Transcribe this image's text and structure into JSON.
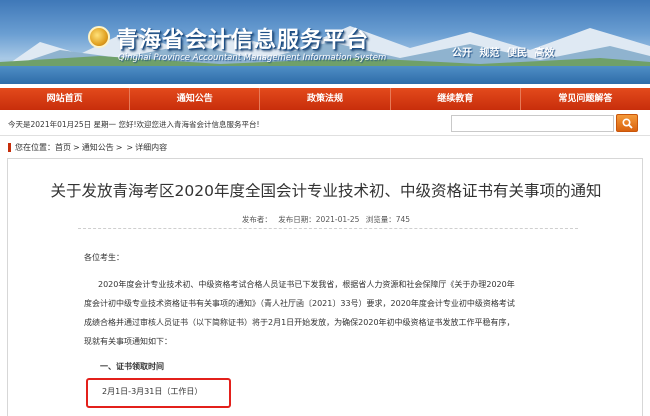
{
  "header": {
    "title": "青海省会计信息服务平台",
    "subtitle": "Qinghai Province Accountant Management Information System",
    "slogan": "公开 规范 便民 高效"
  },
  "nav": {
    "items": [
      "网站首页",
      "通知公告",
      "政策法规",
      "继续教育",
      "常见问题解答"
    ]
  },
  "infobar": {
    "today": "今天是2021年01月25日 星期一  您好!欢迎您进入青海省会计信息服务平台!",
    "search_value": ""
  },
  "breadcrumb": {
    "prefix": "您在位置：",
    "items": [
      "首页",
      "通知公告",
      "详细内容"
    ],
    "separator": ">"
  },
  "article": {
    "title": "关于发放青海考区2020年度全国会计专业技术初、中级资格证书有关事项的通知",
    "meta_source": "发布者：",
    "meta_date": "发布日期：2021-01-25",
    "meta_views": "浏览量：745",
    "greeting": "各位考生：",
    "body_lines": [
      "2020年度会计专业技术初、中级资格考试合格人员证书已下发我省，根据省人力资源和社会保障厅《关于办理2020年",
      "度会计初中级专业技术资格证书有关事项的通知》（青人社厅函〔2021〕33号）要求，2020年度会计专业初中级资格考试",
      "成绩合格并通过审核人员证书（以下简称证书）将于2月1日开始发放，为确保2020年初中级资格证书发放工作平稳有序，",
      "现就有关事项通知如下："
    ],
    "section_heading": "一、证书领取时间",
    "highlight_text": "2月1日-3月31日（工作日）"
  },
  "colors": {
    "nav_red": "#d8391a",
    "highlight_border": "#e3201b",
    "search_orange": "#e9771f"
  }
}
